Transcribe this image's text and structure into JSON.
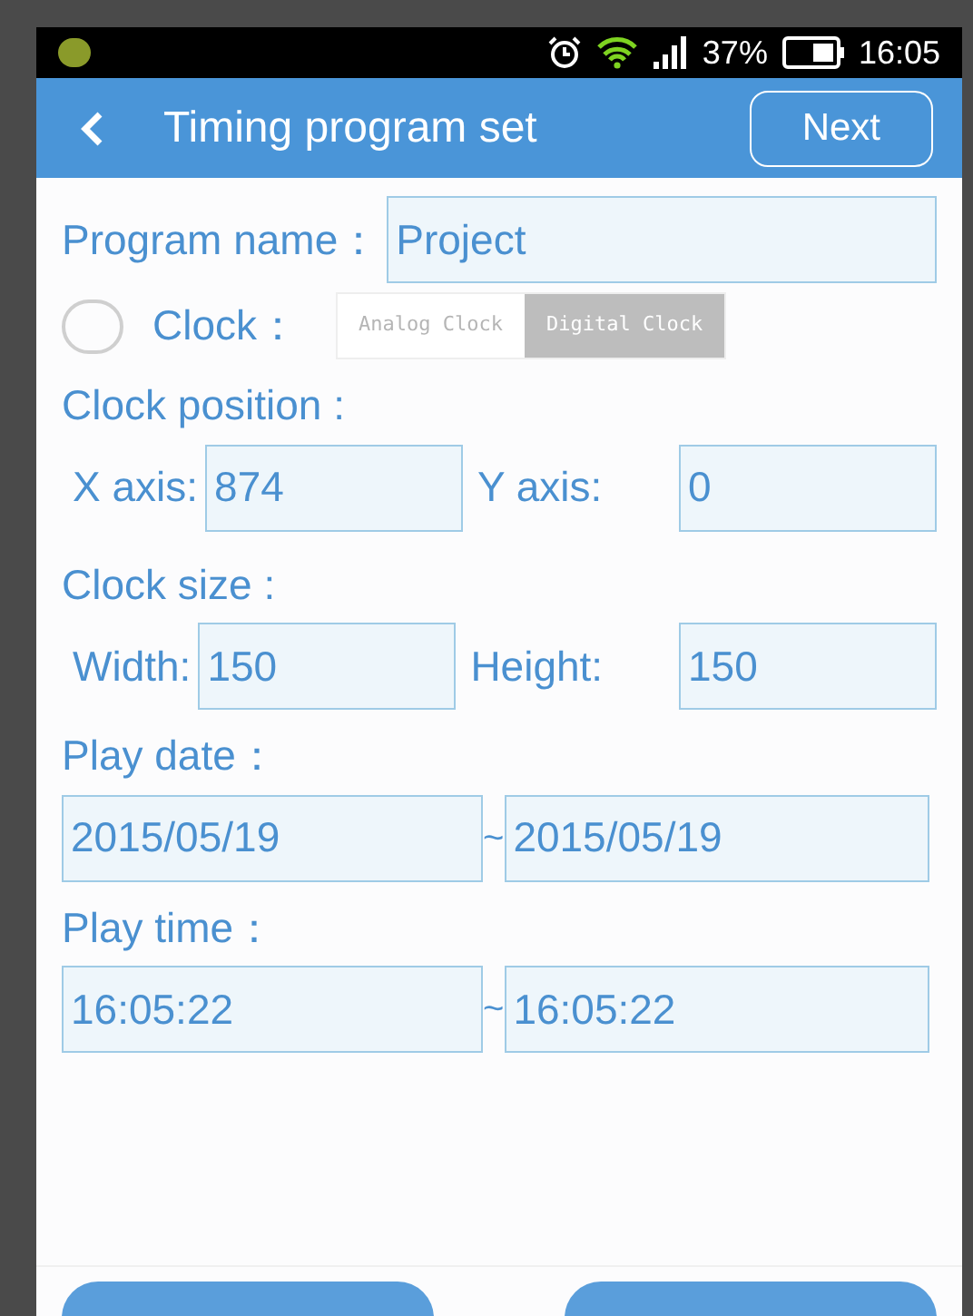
{
  "status_bar": {
    "battery": "37%",
    "time": "16:05"
  },
  "header": {
    "title": "Timing program set",
    "next_button": "Next"
  },
  "program_name": {
    "label": "Program name：",
    "value": "Project"
  },
  "clock": {
    "label": "Clock：",
    "checked": false,
    "options": [
      {
        "label": "Analog Clock",
        "selected": false
      },
      {
        "label": "Digital Clock",
        "selected": true
      }
    ]
  },
  "clock_position": {
    "label": "Clock position :",
    "fields": [
      {
        "label": "X axis:",
        "value": "874"
      },
      {
        "label": "Y axis:",
        "value": "0"
      }
    ]
  },
  "clock_size": {
    "label": "Clock size :",
    "fields": [
      {
        "label": "Width:",
        "value": "150"
      },
      {
        "label": "Height:",
        "value": "150"
      }
    ]
  },
  "play_date": {
    "label": "Play date：",
    "start": "2015/05/19",
    "separator": "~",
    "end": "2015/05/19"
  },
  "play_time": {
    "label": "Play time：",
    "start": "16:05:22",
    "separator": "~",
    "end": "16:05:22"
  }
}
